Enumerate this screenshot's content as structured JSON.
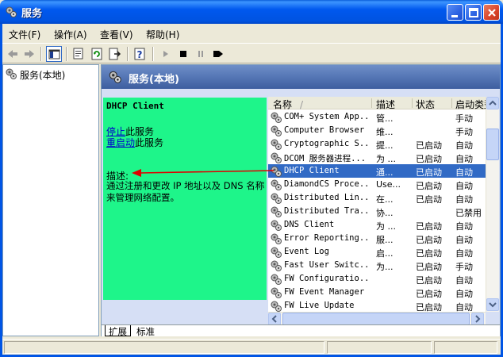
{
  "window": {
    "title": "服务"
  },
  "menu": [
    "文件(F)",
    "操作(A)",
    "查看(V)",
    "帮助(H)"
  ],
  "tree": {
    "item": "服务(本地)"
  },
  "pane": {
    "title": "服务(本地)"
  },
  "description": {
    "service_name": "DHCP Client",
    "stop_link": "停止",
    "stop_suffix": "此服务",
    "restart_link": "重启动",
    "restart_suffix": "此服务",
    "label": "描述:",
    "text": "通过注册和更改 IP 地址以及 DNS 名称来管理网络配置。"
  },
  "columns": {
    "name": "名称",
    "desc": "描述",
    "status": "状态",
    "start": "启动类型"
  },
  "services": [
    {
      "name": "COM+ System App...",
      "desc": "管...",
      "status": "",
      "start": "手动"
    },
    {
      "name": "Computer Browser",
      "desc": "维...",
      "status": "",
      "start": "手动"
    },
    {
      "name": "Cryptographic S...",
      "desc": "提...",
      "status": "已启动",
      "start": "自动"
    },
    {
      "name": "DCOM 服务器进程...",
      "desc": "为 ...",
      "status": "已启动",
      "start": "自动"
    },
    {
      "name": "DHCP Client",
      "desc": "通...",
      "status": "已启动",
      "start": "自动"
    },
    {
      "name": "DiamondCS Proce...",
      "desc": "Use...",
      "status": "已启动",
      "start": "自动"
    },
    {
      "name": "Distributed Lin...",
      "desc": "在...",
      "status": "已启动",
      "start": "自动"
    },
    {
      "name": "Distributed Tra...",
      "desc": "协...",
      "status": "",
      "start": "已禁用"
    },
    {
      "name": "DNS Client",
      "desc": "为 ...",
      "status": "已启动",
      "start": "自动"
    },
    {
      "name": "Error Reporting...",
      "desc": "服...",
      "status": "已启动",
      "start": "自动"
    },
    {
      "name": "Event Log",
      "desc": "启...",
      "status": "已启动",
      "start": "自动"
    },
    {
      "name": "Fast User Switc...",
      "desc": "为...",
      "status": "已启动",
      "start": "手动"
    },
    {
      "name": "FW Configuratio...",
      "desc": "",
      "status": "已启动",
      "start": "自动"
    },
    {
      "name": "FW Event Manager",
      "desc": "",
      "status": "已启动",
      "start": "自动"
    },
    {
      "name": "FW Live Update",
      "desc": "",
      "status": "已启动",
      "start": "自动"
    }
  ],
  "selected_service": "DHCP Client",
  "tabs": [
    "扩展",
    "标准"
  ],
  "active_tab": "扩展",
  "colors": {
    "desc_panel": "#1EF58A",
    "selection": "#316AC5",
    "annotation_arrow": "#E00000"
  }
}
